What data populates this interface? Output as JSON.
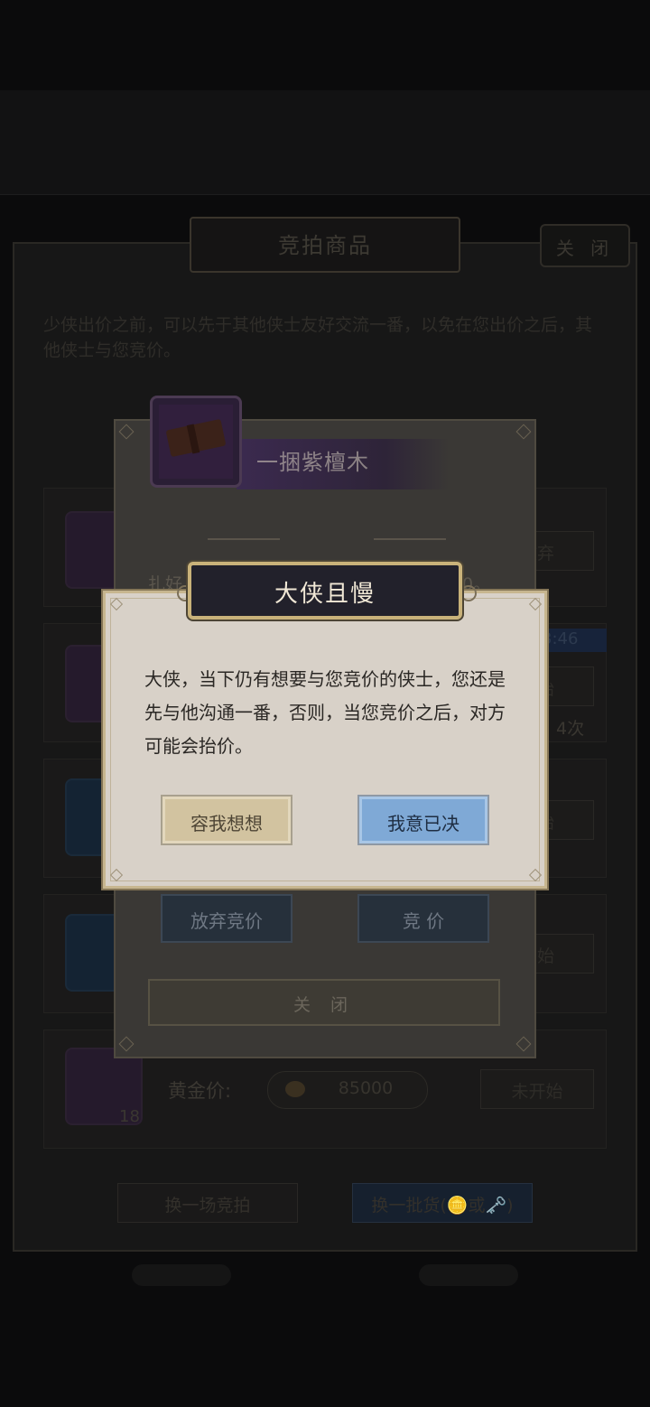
{
  "background": {
    "panel_title": "竞拍商品",
    "close_label": "关 闭",
    "description": "少侠出价之前，可以先于其他侠士友好交流一番，以免在您出价之后，其他侠士与您竞价。",
    "rows": [
      {
        "button": "放弃"
      },
      {
        "button": "开始",
        "timer": "3:46",
        "count": "4次"
      },
      {
        "button": "开始"
      },
      {
        "button": "开始"
      },
      {
        "button": "未开始",
        "gold_label": "黄金价:",
        "gold_value": "85000",
        "qty": "18"
      }
    ],
    "swap_auction_label": "换一场竞拍",
    "swap_goods_label": "换一批货(🪙或🗝️)"
  },
  "item_dialog": {
    "item_name": "一捆紫檀木",
    "text_start": "扎好",
    "text_end": "0。",
    "give_up_label": "放弃竞价",
    "bid_label": "竞 价",
    "close_label": "关 闭"
  },
  "alert": {
    "title": "大侠且慢",
    "message": "大侠，当下仍有想要与您竞价的侠士，您还是先与他沟通一番，否则，当您竞价之后，对方可能会抬价。",
    "think_label": "容我想想",
    "decide_label": "我意已决"
  },
  "colors": {
    "alert_bg": "#d8d1c8",
    "title_bg": "#22212b",
    "gold_border": "#c9b27a",
    "decide_blue": "#7fa9d6",
    "think_tan": "#d2c3a0"
  }
}
